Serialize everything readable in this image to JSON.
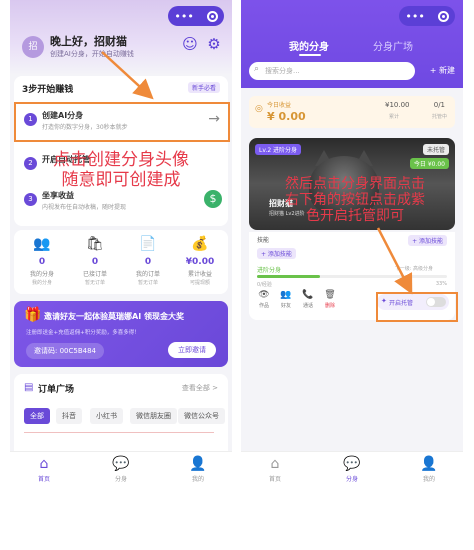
{
  "left": {
    "capsule": {
      "menu_glyph": "•••"
    },
    "header": {
      "avatar_text": "招",
      "greeting": "晚上好，招财猫",
      "subtitle": "创建AI分身，开始自动赚钱"
    },
    "steps": {
      "title": "3步开始赚钱",
      "badge": "新手必看",
      "items": [
        {
          "num": "1",
          "title": "创建AI分身",
          "desc": "打造你的数字分身，30秒本就步"
        },
        {
          "num": "2",
          "title": "开启自动托管",
          "desc": ""
        },
        {
          "num": "3",
          "title": "坐享收益",
          "desc": "内视发布任自动收稿，随时提现"
        }
      ]
    },
    "annotation": "点击创建分身头像\n随意即可创建成",
    "stats": [
      {
        "icon": "👥",
        "value": "0",
        "label": "我的分身",
        "sub": "我的分身"
      },
      {
        "icon": "🛍",
        "value": "0",
        "label": "已接订单",
        "sub": "暂无订单"
      },
      {
        "icon": "📄",
        "value": "0",
        "label": "我的订单",
        "sub": "暂无订单"
      },
      {
        "icon": "💰",
        "value": "¥0.00",
        "label": "累计收益",
        "sub": "可提现额"
      }
    ],
    "invite": {
      "gift": "🎁",
      "title": "邀请好友一起体验莫瑞娜AI 领现金大奖",
      "sub": "注册即送金+充值返佣+积分奖励，多喜多得！",
      "code": "邀请码: 00C5B484",
      "button": "立即邀请"
    },
    "orders": {
      "title": "订单广场",
      "more": "查看全部 >",
      "chips": [
        "全部",
        "抖音",
        "小红书",
        "微信朋友圈",
        "微信公众号"
      ]
    },
    "tabbar": [
      {
        "icon": "⌂",
        "label": "首页",
        "active": true
      },
      {
        "icon": "💬",
        "label": "分身",
        "active": false
      },
      {
        "icon": "👤",
        "label": "我的",
        "active": false
      }
    ]
  },
  "right": {
    "capsule": {
      "menu_glyph": "•••"
    },
    "tabs": [
      {
        "label": "我的分身",
        "active": true
      },
      {
        "label": "分身广场",
        "active": false
      }
    ],
    "search": {
      "placeholder": "搜索分身..."
    },
    "new_button": "+ 新建",
    "earnings": {
      "label": "今日收益",
      "value": "¥ 0.00",
      "total": "¥10.00",
      "total_label": "累计",
      "ratio": "0/1",
      "ratio_label": "托管中"
    },
    "avatar_card": {
      "level": "Lv.2 进阶分身",
      "status": "未托管",
      "today": "今日 ¥0.00",
      "name": "招财猫",
      "sub": "招财猫 Lv2进阶"
    },
    "annotation": "然后点击分身界面点击\n右下角的按钮点击成紫\n色开启托管即可",
    "skills": {
      "label": "技能",
      "add_label": "+ 添加技能",
      "add_btn": "+ 添加技能",
      "progress_label": "进阶分身",
      "progress_next": "下一级: 高级分身",
      "progress_pct": 0.33,
      "progress_sub": "0/经验",
      "progress_pct_text": "33%"
    },
    "actions": [
      {
        "icon": "👁",
        "label": "作品"
      },
      {
        "icon": "👥",
        "label": "好友"
      },
      {
        "icon": "📞",
        "label": "通话"
      },
      {
        "icon": "🗑",
        "label": "删除"
      }
    ],
    "toggle": {
      "label": "开启托管",
      "on": false
    },
    "tabbar": [
      {
        "icon": "⌂",
        "label": "首页",
        "active": false
      },
      {
        "icon": "💬",
        "label": "分身",
        "active": true
      },
      {
        "icon": "👤",
        "label": "我的",
        "active": false
      }
    ]
  },
  "colors": {
    "accent": "#6a4ad8",
    "annotation": "#e63a4a",
    "highlight_box": "#ef8a3a"
  }
}
